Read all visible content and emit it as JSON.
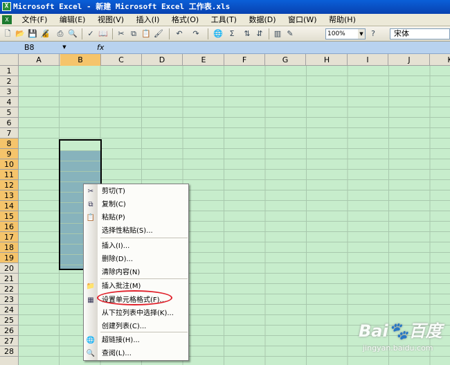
{
  "window": {
    "title": "Microsoft Excel - 新建 Microsoft Excel 工作表.xls"
  },
  "menu": [
    "文件(F)",
    "编辑(E)",
    "视图(V)",
    "插入(I)",
    "格式(O)",
    "工具(T)",
    "数据(D)",
    "窗口(W)",
    "帮助(H)"
  ],
  "toolbar": {
    "zoom": "100%",
    "font": "宋体",
    "icons": [
      "new-icon",
      "open-icon",
      "save-icon",
      "permission-icon",
      "print-icon",
      "print-preview-icon",
      "spelling-icon",
      "research-icon",
      "cut-icon",
      "copy-icon",
      "paste-icon",
      "format-painter-icon",
      "undo-icon",
      "redo-icon",
      "hyperlink-icon",
      "autosum-icon",
      "sort-ascending-icon",
      "sort-descending-icon",
      "chart-wizard-icon",
      "drawing-icon",
      "help-icon"
    ]
  },
  "formula": {
    "name_box": "B8",
    "fx": "fx"
  },
  "columns": [
    "A",
    "B",
    "C",
    "D",
    "E",
    "F",
    "G",
    "H",
    "I",
    "J",
    "K"
  ],
  "rows": [
    "1",
    "2",
    "3",
    "4",
    "5",
    "6",
    "7",
    "8",
    "9",
    "10",
    "11",
    "12",
    "13",
    "14",
    "15",
    "16",
    "17",
    "18",
    "19",
    "20",
    "21",
    "22",
    "23",
    "24",
    "25",
    "26",
    "27",
    "28"
  ],
  "selected": {
    "column": "B",
    "rows_from": 8,
    "rows_to": 19
  },
  "context_menu": [
    {
      "label": "剪切(T)",
      "icon": "scissors-icon"
    },
    {
      "label": "复制(C)",
      "icon": "copy-icon"
    },
    {
      "label": "粘贴(P)",
      "icon": "paste-icon"
    },
    {
      "label": "选择性粘贴(S)...",
      "icon": ""
    },
    {
      "label": "插入(I)...",
      "icon": ""
    },
    {
      "label": "删除(D)...",
      "icon": ""
    },
    {
      "label": "清除内容(N)",
      "icon": ""
    },
    {
      "label": "插入批注(M)",
      "icon": "comment-icon"
    },
    {
      "label": "设置单元格格式(F)...",
      "icon": "format-cells-icon"
    },
    {
      "label": "从下拉列表中选择(K)...",
      "icon": ""
    },
    {
      "label": "创建列表(C)...",
      "icon": ""
    },
    {
      "label": "超链接(H)...",
      "icon": "hyperlink-icon"
    },
    {
      "label": "查阅(L)...",
      "icon": "lookup-icon"
    }
  ],
  "watermark": {
    "logo": "Bai🐾百度",
    "sub": "jingyan.baidu.com"
  }
}
